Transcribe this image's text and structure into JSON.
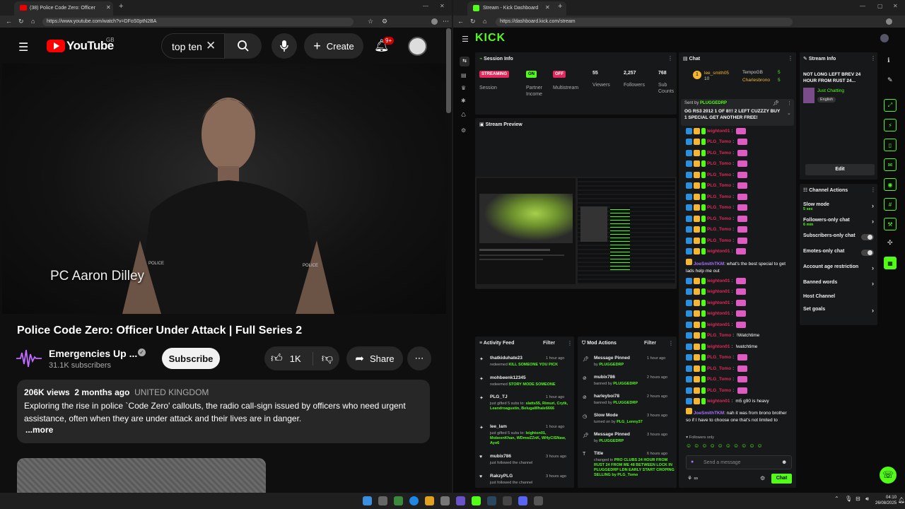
{
  "youtube": {
    "tab_title": "(38) Police Code Zero: Officer",
    "url": "https://www.youtube.com/watch?v=DFoS0ptN2BA",
    "logo": "YouTube",
    "region": "GB",
    "search_value": "top ten",
    "create_label": "Create",
    "notif_count": "9+",
    "video_caption": "PC Aaron Dilley",
    "video_title": "Police Code Zero: Officer Under Attack | Full Series 2",
    "channel_name": "Emergencies Up ...",
    "subscribers": "31.1K subscribers",
    "subscribe_label": "Subscribe",
    "likes": "1K",
    "share_label": "Share",
    "views": "206K views",
    "age": "2 months ago",
    "location": "UNITED KINGDOM",
    "description": "Exploring the rise in police `Code Zero' callouts, the radio call-sign issued by officers who need urgent assistance, often when they are under attack and their lives are in danger.",
    "more": "...more"
  },
  "kick": {
    "tab_title": "Stream - Kick Dashboard",
    "url": "https://dashboard.kick.com/stream",
    "logo": "KICK",
    "session": {
      "title": "Session Info",
      "stats": [
        {
          "badge": "STREAMING",
          "badge_color": "#e0285b",
          "label": "Session"
        },
        {
          "badge": "ON",
          "badge_color": "#53fc18",
          "label": "Partner Income"
        },
        {
          "badge": "OFF",
          "badge_color": "#e0285b",
          "label": "Multistream"
        },
        {
          "value": "55",
          "label": "Viewers"
        },
        {
          "value": "2,257",
          "label": "Followers"
        },
        {
          "value": "768",
          "label": "Sub Counts"
        }
      ]
    },
    "preview_title": "Stream Preview",
    "activity": {
      "title": "Activity Feed",
      "filter": "Filter",
      "items": [
        {
          "user": "thatkiduhate23",
          "time": "1 hour ago",
          "line1": "redeemed",
          "line1b": "KILL SOMEONE YOU PICK"
        },
        {
          "user": "mohbeenk12345",
          "time": "",
          "line1": "redeemed",
          "line1b": "STORY MODE SOMEONE"
        },
        {
          "user": "PLG_TJ",
          "time": "1 hour ago",
          "line1": "just gifted 5 subs to:",
          "line1b": "slatts55, Rimuri, Crytk, Leandroagustin, BelugaWhale6666"
        },
        {
          "user": "lee_lam",
          "time": "1 hour ago",
          "line1": "just gifted 5 subs to:",
          "line1b": "leighton01, MobeenKhan, WDmwZZnK, WHyClSNaw, Ayo6"
        },
        {
          "user": "mubix786",
          "time": "3 hours ago",
          "line1": "just followed the channel",
          "line1b": ""
        },
        {
          "user": "RakzyPLG",
          "time": "3 hours ago",
          "line1": "just followed the channel",
          "line1b": ""
        }
      ]
    },
    "mod": {
      "title": "Mod Actions",
      "filter": "Filter",
      "items": [
        {
          "title": "Message Pinned",
          "time": "1 hour ago",
          "by": "by",
          "who": "PLUGGEDRP"
        },
        {
          "title": "mubix786",
          "time": "2 hours ago",
          "by": "banned by",
          "who": "PLUGGEDRP"
        },
        {
          "title": "harleyboi78",
          "time": "2 hours ago",
          "by": "banned by",
          "who": "PLUGGEDRP"
        },
        {
          "title": "Slow Mode",
          "time": "3 hours ago",
          "by": "turned on by",
          "who": "PLG_Lenny37"
        },
        {
          "title": "Message Pinned",
          "time": "3 hours ago",
          "by": "by",
          "who": "PLUGGEDRP"
        },
        {
          "title": "Title",
          "time": "6 hours ago",
          "by": "changed to",
          "who": "PRO CLUBS 24 HOUR FROM RUST 24 FROM ME 48 BETWEEN LOCK IN PLUGGEDRP LDN EARLY START CROPING SELLING by PLG_Tomo"
        }
      ]
    },
    "chat": {
      "title": "Chat",
      "top": [
        {
          "name": "lee_smith05",
          "count": "10",
          "rank": "1"
        },
        {
          "name": "TempoGB",
          "count": "5"
        },
        {
          "name": "Charlesbrono",
          "count": "5"
        }
      ],
      "pinned_sender": "Sent by",
      "pinned_user": "PLUGGEDRP",
      "pinned_text": "OG RS3 2012 1 OF 8!!! 2 LEFT CUZZZY BUY 1 SPECIAL GET ANOTHER FREE!",
      "messages": [
        {
          "user": "leighton01",
          "color": "#e0285b",
          "text": ""
        },
        {
          "user": "PLG_Tomo",
          "color": "#e0285b",
          "text": ""
        },
        {
          "user": "PLG_Tomo",
          "color": "#e0285b",
          "text": ""
        },
        {
          "user": "PLG_Tomo",
          "color": "#e0285b",
          "text": ""
        },
        {
          "user": "PLG_Tomo",
          "color": "#e0285b",
          "text": ""
        },
        {
          "user": "PLG_Tomo",
          "color": "#e0285b",
          "text": ""
        },
        {
          "user": "PLG_Tomo",
          "color": "#e0285b",
          "text": ""
        },
        {
          "user": "PLG_Tomo",
          "color": "#e0285b",
          "text": ""
        },
        {
          "user": "PLG_Tomo",
          "color": "#e0285b",
          "text": ""
        },
        {
          "user": "PLG_Tomo",
          "color": "#e0285b",
          "text": ""
        },
        {
          "user": "PLG_Tomo",
          "color": "#e0285b",
          "text": ""
        },
        {
          "user": "leighton01",
          "color": "#e0285b",
          "text": ""
        }
      ],
      "joe1_user": "JoeSmithTKM",
      "joe1_text": "what's the best special to get lads help me out",
      "messages2": [
        {
          "user": "leighton01",
          "color": "#e0285b",
          "text": ""
        },
        {
          "user": "leighton01",
          "color": "#e0285b",
          "text": ""
        },
        {
          "user": "leighton01",
          "color": "#e0285b",
          "text": ""
        },
        {
          "user": "leighton01",
          "color": "#e0285b",
          "text": ""
        },
        {
          "user": "leighton01",
          "color": "#e0285b",
          "text": ""
        },
        {
          "user": "PLG_Tomo",
          "color": "#e0285b",
          "text": "!Watchtime"
        },
        {
          "user": "leighton01",
          "color": "#e0285b",
          "text": "!watchtime"
        },
        {
          "user": "PLG_Tomo",
          "color": "#e0285b",
          "text": ""
        },
        {
          "user": "PLG_Tomo",
          "color": "#e0285b",
          "text": ""
        },
        {
          "user": "PLG_Tomo",
          "color": "#e0285b",
          "text": ""
        },
        {
          "user": "PLG_Tomo",
          "color": "#e0285b",
          "text": ""
        },
        {
          "user": "leighton01",
          "color": "#e0285b",
          "text": "m5 g90 is heavy"
        }
      ],
      "joe2_user": "JoeSmithTKM",
      "joe2_text": "nah it was from brono brother so if I have to choose one that's not limited to",
      "followers_only": "Followers only",
      "placeholder": "Send a message",
      "send": "Chat"
    },
    "info": {
      "title": "Stream Info",
      "stream_title": "NOT LONG LEFT BREV 24 HOUR FROM RUST 24...",
      "category": "Just Chatting",
      "language": "English",
      "edit": "Edit"
    },
    "actions": {
      "title": "Channel Actions",
      "items": [
        {
          "label": "Slow mode",
          "sub": "5 sec",
          "ctl": "chevron"
        },
        {
          "label": "Followers-only chat",
          "sub": "6 min",
          "ctl": "chevron"
        },
        {
          "label": "Subscribers-only chat",
          "sub": "",
          "ctl": "toggle"
        },
        {
          "label": "Emotes-only chat",
          "sub": "",
          "ctl": "toggle"
        },
        {
          "label": "Account age restriction",
          "sub": "",
          "ctl": "chevron"
        },
        {
          "label": "Banned words",
          "sub": "",
          "ctl": "chevron"
        },
        {
          "label": "Host Channel",
          "sub": "",
          "ctl": "none"
        },
        {
          "label": "Set goals",
          "sub": "",
          "ctl": "chevron"
        }
      ]
    }
  },
  "taskbar": {
    "time": "04:10",
    "date": "26/08/2025"
  }
}
